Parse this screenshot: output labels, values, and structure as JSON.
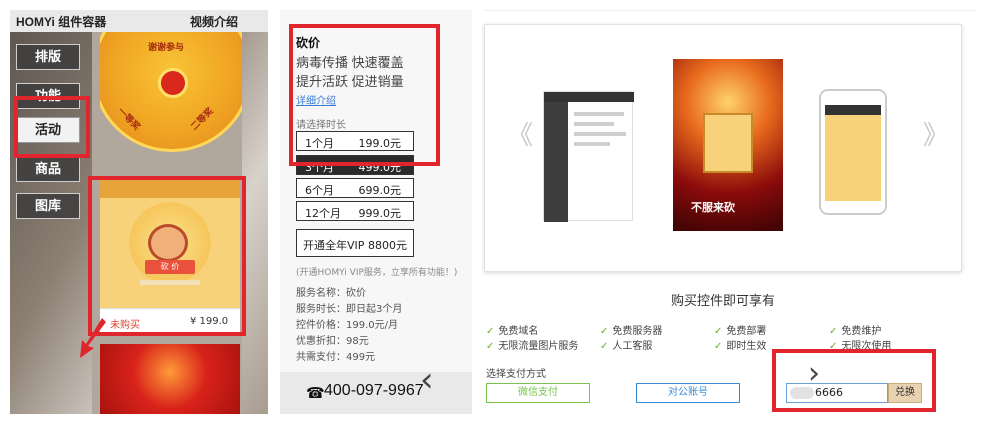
{
  "left_panel": {
    "app_name": "HOMYi 组件容器",
    "video_link": "视频介绍",
    "nav": [
      {
        "label": "排版",
        "active": false
      },
      {
        "label": "功能",
        "active": false
      },
      {
        "label": "活动",
        "active": true
      },
      {
        "label": "商品",
        "active": false
      },
      {
        "label": "图库",
        "active": false
      }
    ],
    "wheel_texts": [
      "谢谢参与",
      "一等奖",
      "二等奖"
    ],
    "card": {
      "button": "砍 价",
      "status": "未购买",
      "price": "¥ 199.0"
    }
  },
  "middle_panel": {
    "title": "砍价",
    "slogan_line1": "病毒传播 快速覆盖",
    "slogan_line2": "提升活跃 促进销量",
    "detail_link": "详细介绍",
    "select_label": "请选择时长",
    "durations": [
      {
        "label": "1个月",
        "price": "199.0元",
        "selected": false
      },
      {
        "label": "3个月",
        "price": "499.0元",
        "selected": true
      },
      {
        "label": "6个月",
        "price": "699.0元",
        "selected": false
      },
      {
        "label": "12个月",
        "price": "999.0元",
        "selected": false
      }
    ],
    "vip": {
      "label": "开通全年VIP",
      "price": "8800元"
    },
    "vip_note": "(开通HOMYi VIP服务，立享所有功能！)",
    "info": [
      "服务名称：砍价",
      "服务时长：即日起3个月",
      "控件价格：199.0元/月",
      "优惠折扣：98元",
      "共需支付：499元"
    ],
    "phone_icon": "☎",
    "phone": "400-097-9967",
    "chevron": "‹"
  },
  "right_panel": {
    "carousel_prev": "《",
    "carousel_next": "》",
    "shot2_text": "不服来砍",
    "enjoy_title": "购买控件即可享有",
    "features": [
      [
        "免费域名",
        "免费服务器",
        "免费部署",
        "免费维护"
      ],
      [
        "无限流量图片服务",
        "人工客服",
        "即时生效",
        "无限次使用"
      ]
    ],
    "pay_label": "选择支付方式",
    "pay_wechat": "微信支付",
    "pay_corporate": "对公账号",
    "code_value": "6666",
    "redeem": "兑换",
    "chevron": "›"
  },
  "colors": {
    "highlight_red": "#e1252c",
    "check_green": "#6aaa2a",
    "link_blue": "#3a7bd5"
  }
}
